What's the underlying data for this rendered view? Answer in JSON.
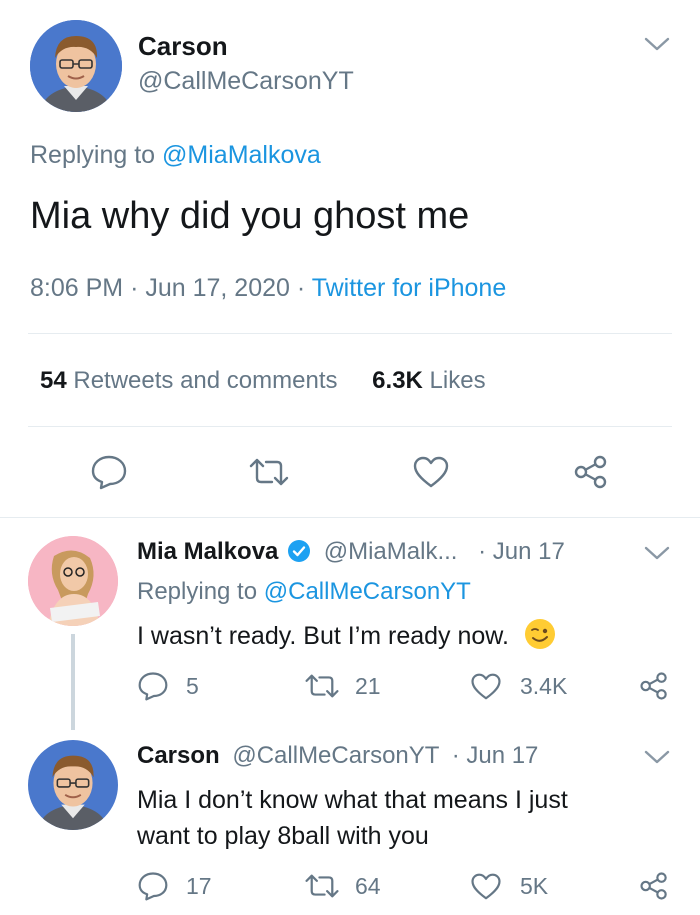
{
  "main_tweet": {
    "author_name": "Carson",
    "author_handle": "@CallMeCarsonYT",
    "replying_prefix": "Replying to",
    "replying_to": "@MiaMalkova",
    "text": "Mia why did you ghost me",
    "time": "8:06 PM",
    "date": "Jun 17, 2020",
    "source": "Twitter for iPhone",
    "retweets_count": "54",
    "retweets_label": "Retweets and comments",
    "likes_count": "6.3K",
    "likes_label": "Likes"
  },
  "replies": [
    {
      "author_name": "Mia Malkova",
      "author_handle": "@MiaMalk...",
      "date": "· Jun 17",
      "replying_prefix": "Replying to",
      "replying_to": "@CallMeCarsonYT",
      "text": "I wasn’t ready. But I’m ready now.",
      "replies_count": "5",
      "retweets_count": "21",
      "likes_count": "3.4K"
    },
    {
      "author_name": "Carson",
      "author_handle": "@CallMeCarsonYT",
      "date": "· Jun 17",
      "text_line1": "Mia I don’t know what that means I just",
      "text_line2": "want to play 8ball with you",
      "replies_count": "17",
      "retweets_count": "64",
      "likes_count": "5K"
    }
  ],
  "colors": {
    "link_blue": "#1b95e0",
    "secondary_gray": "#657786",
    "verified_blue": "#1da1f2"
  }
}
